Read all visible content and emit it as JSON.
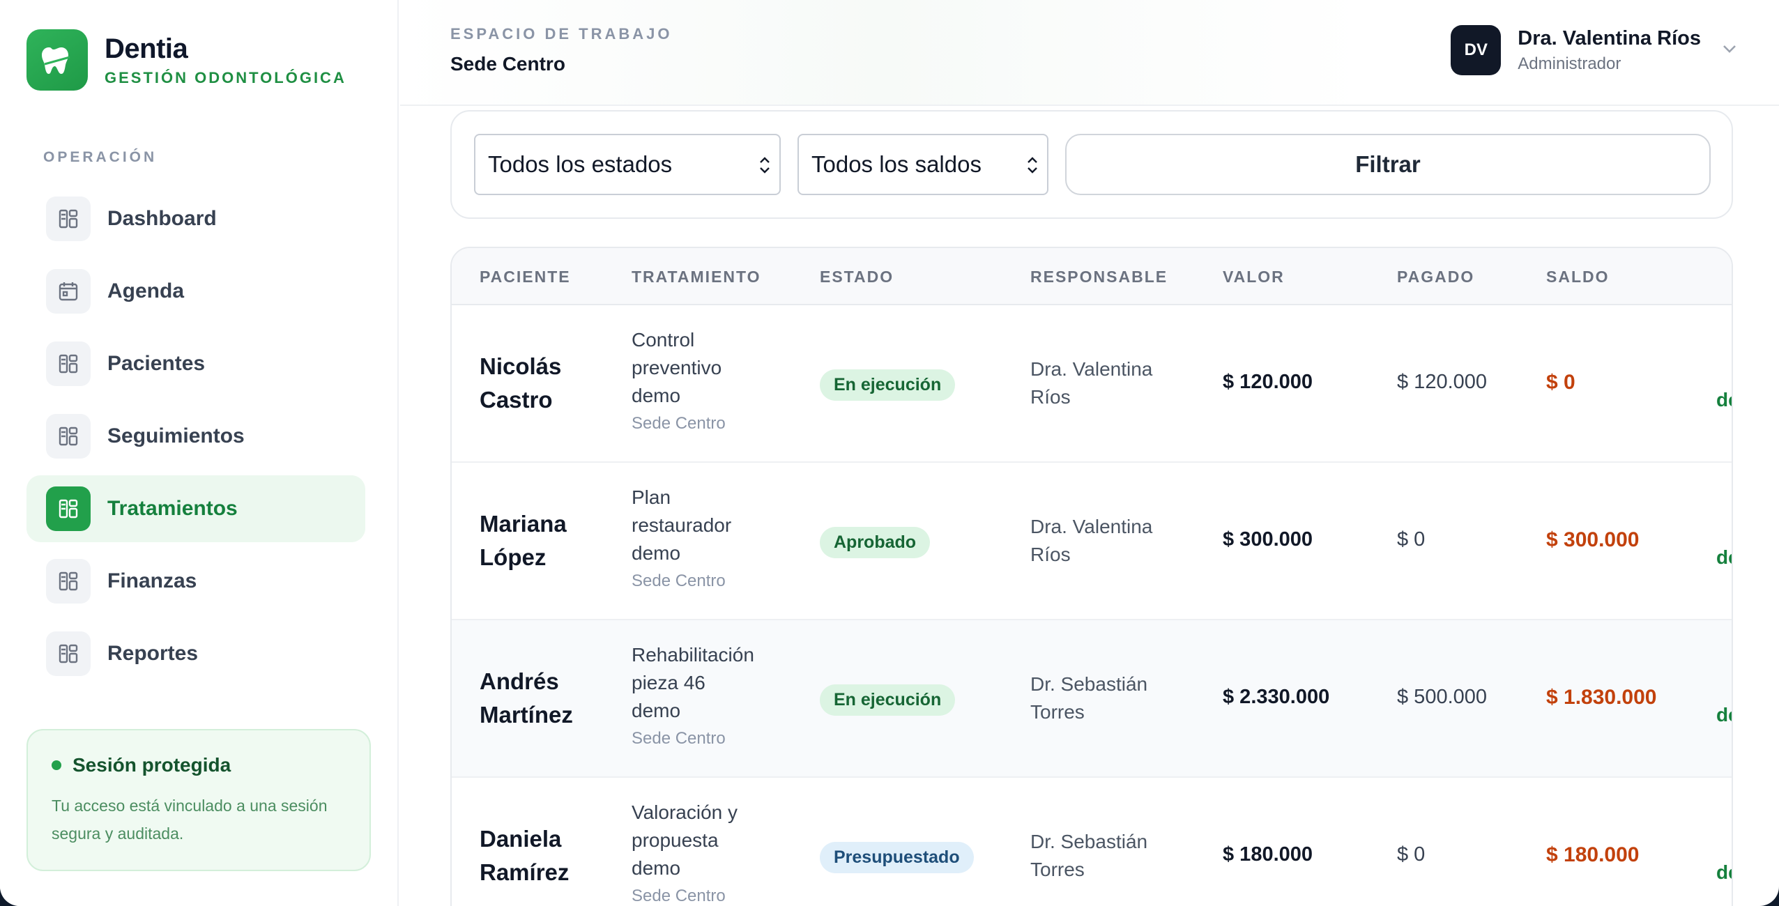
{
  "brand": {
    "name": "Dentia",
    "subtitle": "GESTIÓN ODONTOLÓGICA"
  },
  "sidebar": {
    "section_label": "OPERACIÓN",
    "items": [
      {
        "label": "Dashboard",
        "icon": "grid-icon",
        "active": false
      },
      {
        "label": "Agenda",
        "icon": "calendar-icon",
        "active": false
      },
      {
        "label": "Pacientes",
        "icon": "grid-icon",
        "active": false
      },
      {
        "label": "Seguimientos",
        "icon": "grid-icon",
        "active": false
      },
      {
        "label": "Tratamientos",
        "icon": "grid-icon",
        "active": true
      },
      {
        "label": "Finanzas",
        "icon": "grid-icon",
        "active": false
      },
      {
        "label": "Reportes",
        "icon": "grid-icon",
        "active": false
      }
    ],
    "session": {
      "title": "Sesión protegida",
      "text": "Tu acceso está vinculado a una sesión segura y auditada."
    }
  },
  "header": {
    "workspace_label": "ESPACIO DE TRABAJO",
    "workspace_value": "Sede Centro",
    "user": {
      "initials": "DV",
      "name": "Dra. Valentina Ríos",
      "role": "Administrador"
    }
  },
  "filters": {
    "estado": "Todos los estados",
    "saldo": "Todos los saldos",
    "button": "Filtrar"
  },
  "table": {
    "columns": [
      "PACIENTE",
      "TRATAMIENTO",
      "ESTADO",
      "RESPONSABLE",
      "VALOR",
      "PAGADO",
      "SALDO"
    ],
    "rows": [
      {
        "patient": [
          "Nicolás",
          "Castro"
        ],
        "treatment": [
          "Control",
          "preventivo",
          "demo"
        ],
        "sede": "Sede Centro",
        "status": "En ejecución",
        "status_tone": "green",
        "responsible": [
          "Dra. Valentina",
          "Ríos"
        ],
        "valor": "$ 120.000",
        "pagado": "$ 120.000",
        "saldo": "$ 0",
        "cut": "de"
      },
      {
        "patient": [
          "Mariana",
          "López"
        ],
        "treatment": [
          "Plan",
          "restaurador",
          "demo"
        ],
        "sede": "Sede Centro",
        "status": "Aprobado",
        "status_tone": "green",
        "responsible": [
          "Dra. Valentina",
          "Ríos"
        ],
        "valor": "$ 300.000",
        "pagado": "$ 0",
        "saldo": "$ 300.000",
        "cut": "de"
      },
      {
        "patient": [
          "Andrés",
          "Martínez"
        ],
        "treatment": [
          "Rehabilitación",
          "pieza 46",
          "demo"
        ],
        "sede": "Sede Centro",
        "status": "En ejecución",
        "status_tone": "green",
        "responsible": [
          "Dr. Sebastián",
          "Torres"
        ],
        "valor": "$ 2.330.000",
        "pagado": "$ 500.000",
        "saldo": "$ 1.830.000",
        "cut": "de"
      },
      {
        "patient": [
          "Daniela",
          "Ramírez"
        ],
        "treatment": [
          "Valoración y",
          "propuesta",
          "demo"
        ],
        "sede": "Sede Centro",
        "status": "Presupuestado",
        "status_tone": "blue",
        "responsible": [
          "Dr. Sebastián",
          "Torres"
        ],
        "valor": "$ 180.000",
        "pagado": "$ 0",
        "saldo": "$ 180.000",
        "cut": "de"
      }
    ]
  },
  "colors": {
    "accent": "#22a04b",
    "saldo": "#c2410c",
    "dark": "#111827"
  }
}
